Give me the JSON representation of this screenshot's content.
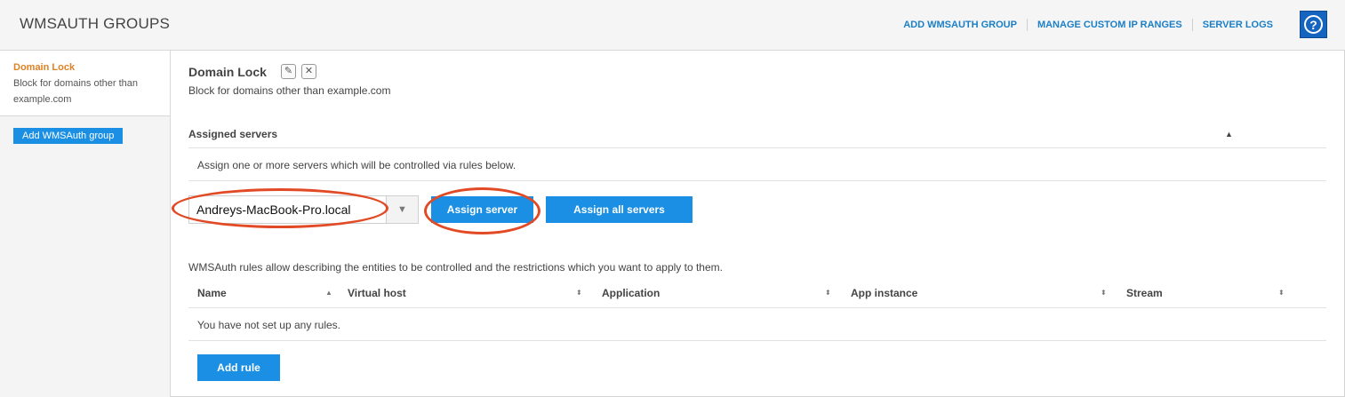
{
  "header": {
    "title": "WMSAUTH GROUPS",
    "nav": [
      "ADD WMSAUTH GROUP",
      "MANAGE CUSTOM IP RANGES",
      "SERVER LOGS"
    ],
    "help_icon": "?"
  },
  "sidebar": {
    "group_title": "Domain Lock",
    "group_desc": "Block for domains other than example.com",
    "add_button": "Add WMSAuth group"
  },
  "main": {
    "group_title": "Domain Lock",
    "edit_icon": "✎",
    "delete_icon": "✕",
    "group_desc": "Block for domains other than example.com",
    "assigned": {
      "title": "Assigned servers",
      "caret": "▲",
      "desc": "Assign one or more servers which will be controlled via rules below.",
      "selected_server": "Andreys-MacBook-Pro.local",
      "select_toggle": "▼",
      "assign_button": "Assign server",
      "assign_all_button": "Assign all servers"
    },
    "rules": {
      "desc": "WMSAuth rules allow describing the entities to be controlled and the restrictions which you want to apply to them.",
      "columns": [
        "Name",
        "Virtual host",
        "Application",
        "App instance",
        "Stream"
      ],
      "sort_asc": "▲",
      "sort_both": "⬍",
      "empty": "You have not set up any rules.",
      "add_button": "Add rule"
    }
  },
  "colors": {
    "accent": "#1a8fe3",
    "link": "#1a7fc6",
    "highlight": "#e08126",
    "annotation": "#e24a26"
  }
}
